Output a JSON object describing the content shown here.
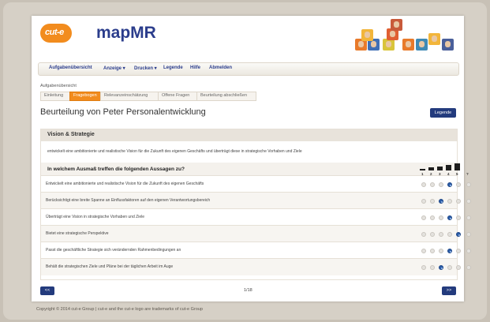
{
  "brand": {
    "logo_text": "cut-e",
    "app_title": "mapMR",
    "primary": "#2b3d8c",
    "accent": "#f28c1e"
  },
  "nav": {
    "items": [
      {
        "label": "Aufgabenübersicht"
      },
      {
        "label": "Anzeige ▾"
      },
      {
        "label": "Drucken ▾"
      },
      {
        "label": "Legende"
      },
      {
        "label": "Hilfe"
      },
      {
        "label": "Abmelden"
      }
    ]
  },
  "breadcrumb": {
    "label": "Aufgabenübersicht",
    "steps": [
      {
        "label": "Einleitung",
        "active": false
      },
      {
        "label": "Fragebogen",
        "active": true
      },
      {
        "label": "Relevanzeinschätzung",
        "active": false
      },
      {
        "label": "Offene Fragen",
        "active": false
      },
      {
        "label": "Beurteilung abschließen",
        "active": false
      }
    ]
  },
  "page": {
    "heading": "Beurteilung von Peter Personalentwicklung",
    "legend_button": "Legende"
  },
  "section": {
    "title": "Vision & Strategie",
    "description": "entwickelt eine ambitionierte und realistische Vision für die Zukunft des eigenen Geschäfts und überträgt diese in strategische Vorhaben und Ziele",
    "question": "In welchem Ausmaß treffen die folgenden Aussagen zu?",
    "scale": [
      "1",
      "2",
      "3",
      "4",
      "5",
      "?"
    ],
    "items": [
      {
        "text": "Entwickelt eine ambitionierte und realistische Vision für die Zukunft des eigenen Geschäfts",
        "selected": 4
      },
      {
        "text": "Berücksichtigt eine breite Spanne an Einflussfaktoren auf den eigenen Verantwortungsbereich",
        "selected": 3
      },
      {
        "text": "Überträgt eine Vision in strategische Vorhaben und Ziele",
        "selected": 4
      },
      {
        "text": "Bietet eine strategische Perspektive",
        "selected": 5
      },
      {
        "text": "Passt die geschäftliche Strategie sich verändernden Rahmenbedingungen an",
        "selected": 4
      },
      {
        "text": "Behält die strategischen Ziele und Pläne bei der täglichen Arbeit im Auge",
        "selected": 3
      }
    ]
  },
  "pager": {
    "prev_label": "<<",
    "next_label": ">>",
    "page_count": "1/18"
  },
  "footer": {
    "text": "Copyright © 2014 cut-e Group | cut-e and the cut-e logo are trademarks of cut-e Group"
  }
}
